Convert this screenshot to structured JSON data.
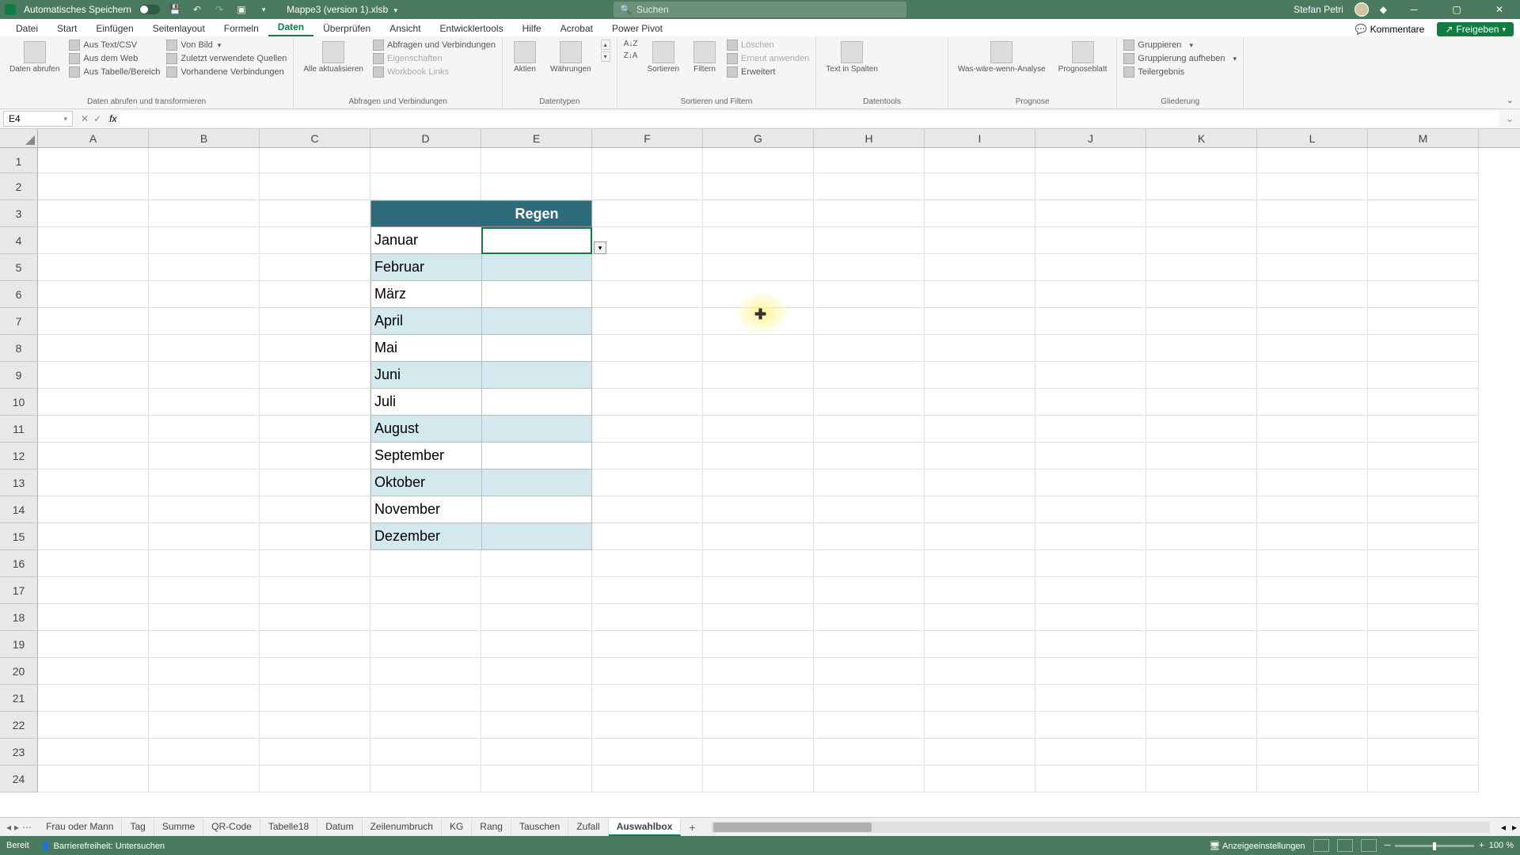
{
  "titlebar": {
    "autosave_label": "Automatisches Speichern",
    "filename": "Mappe3 (version 1).xlsb",
    "search_placeholder": "Suchen",
    "username": "Stefan Petri"
  },
  "menutabs": {
    "items": [
      "Datei",
      "Start",
      "Einfügen",
      "Seitenlayout",
      "Formeln",
      "Daten",
      "Überprüfen",
      "Ansicht",
      "Entwicklertools",
      "Hilfe",
      "Acrobat",
      "Power Pivot"
    ],
    "active_index": 5,
    "comments": "Kommentare",
    "share": "Freigeben"
  },
  "ribbon": {
    "g1": {
      "big": "Daten abrufen",
      "items": [
        "Aus Text/CSV",
        "Aus dem Web",
        "Aus Tabelle/Bereich",
        "Von Bild",
        "Zuletzt verwendete Quellen",
        "Vorhandene Verbindungen"
      ],
      "label": "Daten abrufen und transformieren"
    },
    "g2": {
      "big": "Alle aktualisieren",
      "items": [
        "Abfragen und Verbindungen",
        "Eigenschaften",
        "Workbook Links"
      ],
      "label": "Abfragen und Verbindungen"
    },
    "g3": {
      "items": [
        "Aktien",
        "Währungen"
      ],
      "label": "Datentypen"
    },
    "g4": {
      "sort": "Sortieren",
      "filter": "Filtern",
      "items": [
        "Löschen",
        "Erneut anwenden",
        "Erweitert"
      ],
      "label": "Sortieren und Filtern"
    },
    "g5": {
      "big": "Text in Spalten",
      "label": "Datentools"
    },
    "g6": {
      "items": [
        "Was-wäre-wenn-Analyse",
        "Prognoseblatt"
      ],
      "label": "Prognose"
    },
    "g7": {
      "items": [
        "Gruppieren",
        "Gruppierung aufheben",
        "Teilergebnis"
      ],
      "label": "Gliederung"
    }
  },
  "formulabar": {
    "namebox": "E4",
    "fx": "fx"
  },
  "columns": [
    "A",
    "B",
    "C",
    "D",
    "E",
    "F",
    "G",
    "H",
    "I",
    "J",
    "K",
    "L",
    "M"
  ],
  "rows_visible": 24,
  "table": {
    "header": "Regen",
    "months": [
      "Januar",
      "Februar",
      "März",
      "April",
      "Mai",
      "Juni",
      "Juli",
      "August",
      "September",
      "Oktober",
      "November",
      "Dezember"
    ]
  },
  "sheets": {
    "items": [
      "Frau oder Mann",
      "Tag",
      "Summe",
      "QR-Code",
      "Tabelle18",
      "Datum",
      "Zeilenumbruch",
      "KG",
      "Rang",
      "Tauschen",
      "Zufall",
      "Auswahlbox"
    ],
    "active_index": 11
  },
  "statusbar": {
    "ready": "Bereit",
    "accessibility": "Barrierefreiheit: Untersuchen",
    "display_settings": "Anzeigeeinstellungen",
    "zoom": "100 %"
  }
}
